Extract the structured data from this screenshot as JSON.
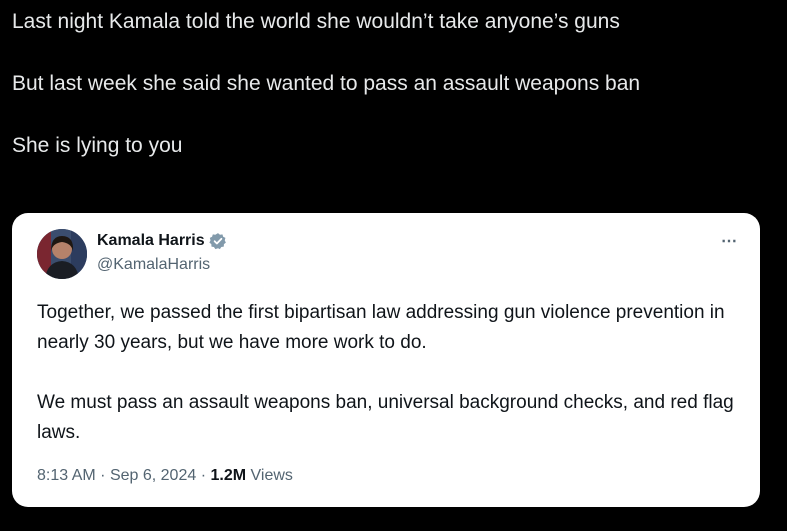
{
  "post": {
    "line1": "Last night Kamala told the world she wouldn’t take anyone’s guns",
    "line2": "But last week she said she wanted to pass an assault weapons ban",
    "line3": "She is lying to you"
  },
  "quoted_tweet": {
    "author_name": "Kamala Harris",
    "handle": "@KamalaHarris",
    "more_icon": "⋯",
    "paragraph1": "Together, we passed the first bipartisan law addressing gun violence prevention in nearly 30 years, but we have more work to do.",
    "paragraph2": "We must pass an assault weapons ban, universal background checks, and red flag laws.",
    "time": "8:13 AM",
    "separator": "·",
    "date": "Sep 6, 2024",
    "views_count": "1.2M",
    "views_label": "Views",
    "verified_color": "#829aab"
  }
}
